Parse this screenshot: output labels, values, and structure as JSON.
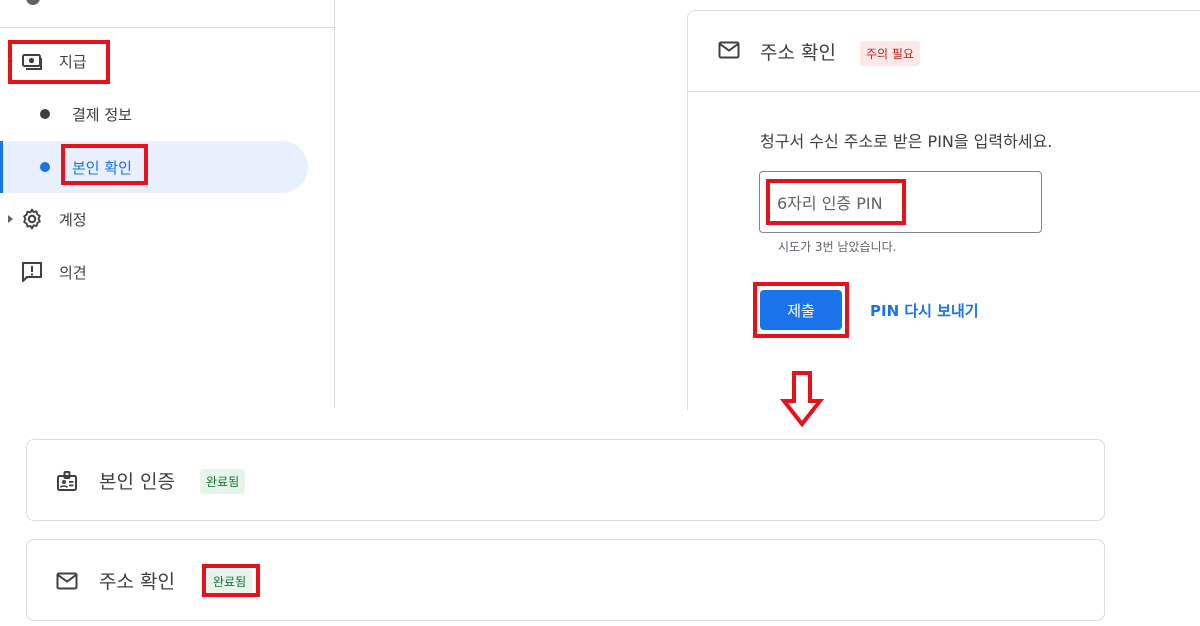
{
  "sidebar": {
    "items": [
      {
        "label": "지급",
        "icon": "payments-icon"
      },
      {
        "label": "결제 정보"
      },
      {
        "label": "본인 확인"
      },
      {
        "label": "계정",
        "icon": "gear-icon"
      },
      {
        "label": "의견",
        "icon": "feedback-icon"
      }
    ]
  },
  "address_card": {
    "title": "주소 확인",
    "status": "주의 필요",
    "instruction": "청구서 수신 주소로 받은 PIN을 입력하세요.",
    "pin_placeholder": "6자리 인증 PIN",
    "attempts_hint": "시도가 3번 남았습니다.",
    "submit_label": "제출",
    "resend_label": "PIN 다시 보내기"
  },
  "result_cards": [
    {
      "title": "본인 인증",
      "status": "완료됨",
      "icon": "id-badge-icon"
    },
    {
      "title": "주소 확인",
      "status": "완료됨",
      "icon": "mail-icon"
    }
  ],
  "colors": {
    "accent": "#1a73e8",
    "highlight_box": "#e3121b",
    "warning_bg": "#fce8e6",
    "warning_text": "#c5221f",
    "success_bg": "#e6f4ea",
    "success_text": "#137333"
  }
}
